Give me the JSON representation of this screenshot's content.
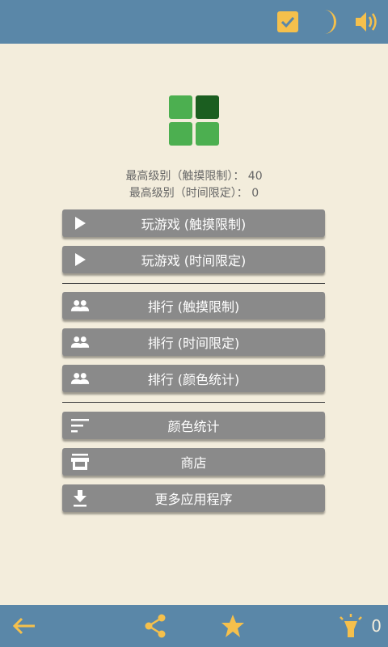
{
  "header": {
    "icons": [
      "checkbox-icon",
      "moon-icon",
      "volume-icon"
    ]
  },
  "logo": {
    "colors": [
      "#4caf50",
      "#1b5e20",
      "#4caf50",
      "#4caf50"
    ]
  },
  "stats": {
    "touch_limit_line": "最高级别（触摸限制）： 40",
    "time_limit_line": "最高级别（时间限定）： 0"
  },
  "buttons": {
    "play_touch": "玩游戏 (触摸限制)",
    "play_time": "玩游戏 (时间限定)",
    "rank_touch": "排行 (触摸限制)",
    "rank_time": "排行 (时间限定)",
    "rank_color": "排行 (颜色统计)",
    "color_stats": "颜色统计",
    "shop": "商店",
    "more_apps": "更多应用程序"
  },
  "footer": {
    "icons": [
      "back-arrow-icon",
      "share-icon",
      "star-icon",
      "hint-icon"
    ],
    "hint_count": "0"
  },
  "colors": {
    "bar": "#5a87a8",
    "accent": "#f5c04c",
    "background": "#f3eddc",
    "button": "#8a8a8a"
  }
}
